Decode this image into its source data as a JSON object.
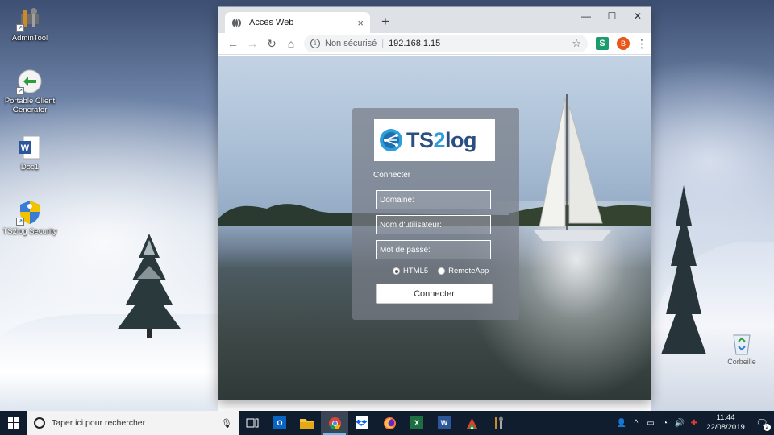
{
  "desktop": {
    "icons": [
      {
        "label": "AdminTool"
      },
      {
        "label": "Portable Client Generator"
      },
      {
        "label": "Doc1"
      },
      {
        "label": "TS2log Security"
      }
    ],
    "recycle_bin": {
      "label": "Corbeille"
    }
  },
  "browser": {
    "tab": {
      "title": "Accès Web"
    },
    "new_tab": "+",
    "controls": {
      "minimize": "—",
      "maximize": "☐",
      "close": "✕"
    },
    "nav": {
      "back": "←",
      "forward": "→",
      "reload": "↻",
      "home": "⌂"
    },
    "address": {
      "security_label": "Non sécurisé",
      "separator": "|",
      "url": "192.168.1.15"
    },
    "extension_label": "S",
    "profile_initial": "B"
  },
  "login": {
    "logo": {
      "part1": "TS",
      "part2": "2",
      "part3": "log"
    },
    "heading": "Connecter",
    "fields": {
      "domain_placeholder": "Domaine:",
      "username_placeholder": "Nom d'utilisateur:",
      "password_placeholder": "Mot de passe:"
    },
    "modes": [
      {
        "label": "HTML5",
        "selected": true
      },
      {
        "label": "RemoteApp",
        "selected": false
      }
    ],
    "submit_label": "Connecter"
  },
  "taskbar": {
    "search_placeholder": "Taper ici pour rechercher",
    "apps": [
      {
        "name": "task-view",
        "label": ""
      },
      {
        "name": "outlook",
        "label": "O"
      },
      {
        "name": "file-explorer",
        "label": ""
      },
      {
        "name": "chrome",
        "label": "",
        "active": true
      },
      {
        "name": "dropbox",
        "label": ""
      },
      {
        "name": "firefox",
        "label": ""
      },
      {
        "name": "excel",
        "label": "X"
      },
      {
        "name": "word",
        "label": "W"
      },
      {
        "name": "acrobat",
        "label": ""
      },
      {
        "name": "admintool",
        "label": ""
      }
    ],
    "clock": {
      "time": "11:44",
      "date": "22/08/2019"
    },
    "notifications_count": "2"
  },
  "colors": {
    "taskbar": "#0f1d2e",
    "logo_blue": "#2a4f80",
    "logo_accent": "#2c9fd9",
    "profile": "#e8561c",
    "extension": "#1b9c6c"
  }
}
